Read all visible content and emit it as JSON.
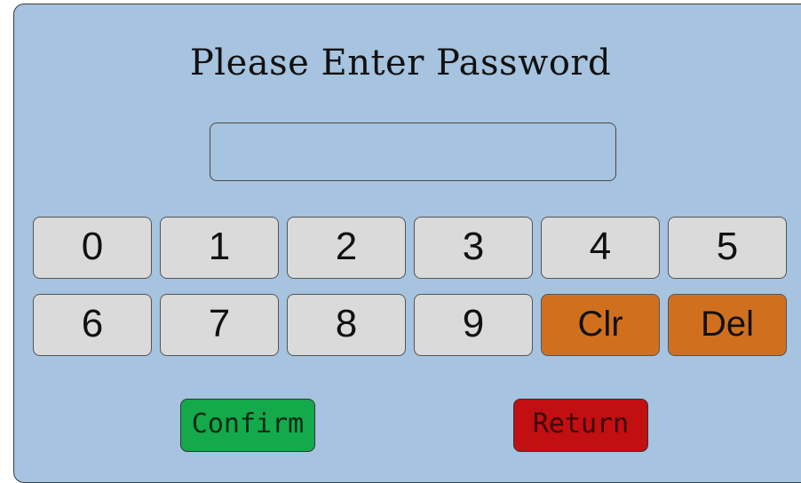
{
  "title": "Please Enter Password",
  "password_field": {
    "value": "",
    "placeholder": ""
  },
  "keypad": {
    "row1": [
      "0",
      "1",
      "2",
      "3",
      "4",
      "5"
    ],
    "row2": [
      "6",
      "7",
      "8",
      "9",
      "Clr",
      "Del"
    ]
  },
  "actions": {
    "confirm_label": "Confirm",
    "return_label": "Return"
  },
  "colors": {
    "background": "#a6c3df",
    "key": "#dadada",
    "edit_key": "#d0701f",
    "confirm": "#14a94b",
    "return": "#c20f12"
  }
}
